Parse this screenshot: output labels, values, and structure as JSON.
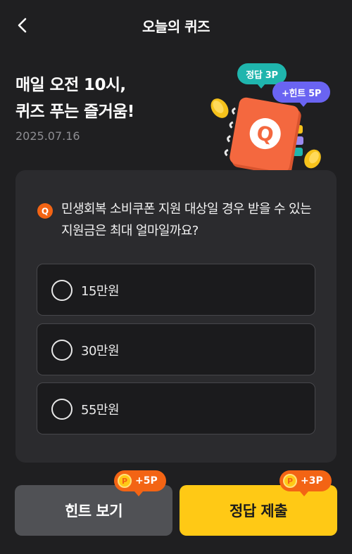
{
  "header": {
    "title": "오늘의 퀴즈"
  },
  "hero": {
    "title_line1": "매일 오전 10시,",
    "title_line2": "퀴즈 푸는 즐거움!",
    "date": "2025.07.16",
    "answer_bubble": "정답 3P",
    "hint_bubble": "+힌트 5P",
    "illustration_letter": "Q"
  },
  "quiz": {
    "icon_letter": "Q",
    "question": "민생회복 소비쿠폰 지원 대상일 경우 받을 수 있는 지원금은 최대 얼마일까요?",
    "options": [
      {
        "label": "15만원",
        "selected": false
      },
      {
        "label": "30만원",
        "selected": false
      },
      {
        "label": "55만원",
        "selected": false
      }
    ]
  },
  "actions": {
    "hint_label": "힌트 보기",
    "hint_reward": "+5P",
    "submit_label": "정답 제출",
    "submit_reward": "+3P",
    "coin_symbol": "P"
  },
  "colors": {
    "background": "#1f1f21",
    "card": "#2b2b2e",
    "accent_yellow": "#ffc915",
    "reward_orange": "#f36414",
    "bubble_teal": "#1fb5ad",
    "bubble_purple": "#6a64f2",
    "notebook_orange": "#f4683f"
  }
}
